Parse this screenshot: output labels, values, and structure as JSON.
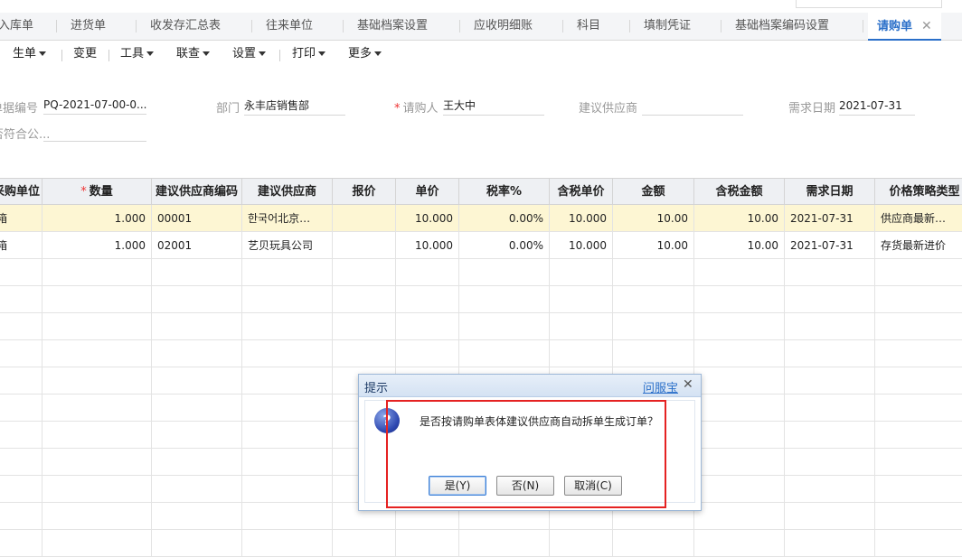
{
  "tabs": [
    {
      "label": "入库单"
    },
    {
      "label": "进货单"
    },
    {
      "label": "收发存汇总表"
    },
    {
      "label": "往来单位"
    },
    {
      "label": "基础档案设置"
    },
    {
      "label": "应收明细账"
    },
    {
      "label": "科目"
    },
    {
      "label": "填制凭证"
    },
    {
      "label": "基础档案编码设置"
    },
    {
      "label": "请购单",
      "active": true
    }
  ],
  "tab_close": "✕",
  "toolbar": {
    "items": [
      {
        "label": "生单"
      },
      {
        "label": "变更"
      },
      {
        "label": "工具"
      },
      {
        "label": "联查"
      },
      {
        "label": "设置"
      },
      {
        "label": "打印"
      },
      {
        "label": "更多"
      }
    ]
  },
  "form": {
    "doc_no_label": "单据编号",
    "doc_no_value": "PQ-2021-07-00-0...",
    "dept_label": "部门",
    "dept_value": "永丰店销售部",
    "requester_label": "请购人",
    "requester_value": "王大中",
    "supplier_label": "建议供应商",
    "supplier_value": "",
    "need_date_label": "需求日期",
    "need_date_value": "2021-07-31",
    "conform_label": "是否符合公..."
  },
  "grid": {
    "headers": [
      "采购单位",
      "数量",
      "建议供应商编码",
      "建议供应商",
      "报价",
      "单价",
      "税率%",
      "含税单价",
      "金额",
      "含税金额",
      "需求日期",
      "价格策略类型"
    ],
    "rows": [
      [
        "箱",
        "1.000",
        "00001",
        "한국어北京…",
        "",
        "10.000",
        "0.00%",
        "10.000",
        "10.00",
        "10.00",
        "2021-07-31",
        "供应商最新…"
      ],
      [
        "箱",
        "1.000",
        "02001",
        "艺贝玩具公司",
        "",
        "10.000",
        "0.00%",
        "10.000",
        "10.00",
        "10.00",
        "2021-07-31",
        "存货最新进价"
      ]
    ]
  },
  "dialog": {
    "title": "提示",
    "help_link": "问服宝",
    "close": "✕",
    "icon_glyph": "?",
    "message": "是否按请购单表体建议供应商自动拆单生成订单？",
    "yes": "是(Y)",
    "no": "否(N)",
    "cancel": "取消(C)"
  }
}
